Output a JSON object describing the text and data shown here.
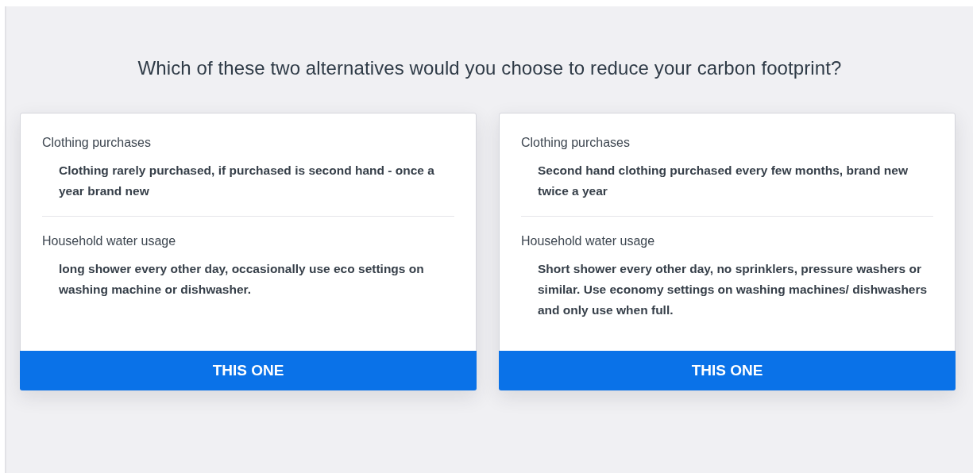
{
  "question": "Which of these two alternatives would you choose to reduce your carbon footprint?",
  "options": [
    {
      "attributes": [
        {
          "label": "Clothing purchases",
          "value": "Clothing rarely purchased, if purchased is second hand - once a year brand new"
        },
        {
          "label": "Household water usage",
          "value": "long shower every other day, occasionally use eco settings on washing machine or dishwasher."
        }
      ],
      "button": "THIS ONE"
    },
    {
      "attributes": [
        {
          "label": "Clothing purchases",
          "value": "Second hand clothing purchased every few months, brand new twice a year"
        },
        {
          "label": "Household water usage",
          "value": "Short shower every other day, no sprinklers, pressure washers or similar. Use economy settings on washing machines/ dishwashers and only use when full."
        }
      ],
      "button": "THIS ONE"
    }
  ]
}
